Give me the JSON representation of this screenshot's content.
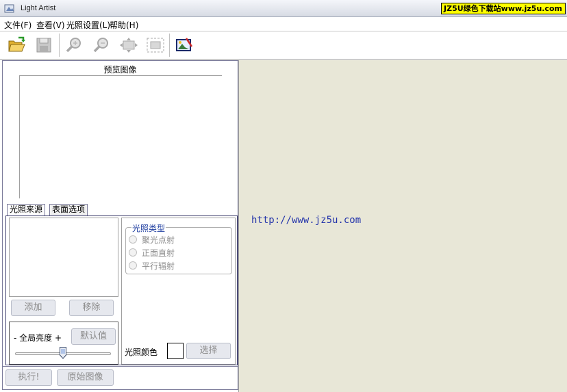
{
  "window": {
    "title": "Light Artist",
    "watermark": "JZ5U绿色下载站www.jz5u.com"
  },
  "menu": {
    "file": "文件(F)",
    "view": "查看(V)",
    "light_settings": "光照设置(L)",
    "help": "帮助(H)"
  },
  "toolbar": {
    "buttons": [
      "open-folder-icon",
      "save-disk-icon",
      "zoom-in-icon",
      "zoom-out-icon",
      "fit-window-icon",
      "actual-size-icon",
      "edit-image-icon"
    ]
  },
  "preview": {
    "label": "预览图像"
  },
  "tabs": {
    "light_source": "光照来源",
    "surface_options": "表面选项"
  },
  "source_panel": {
    "add": "添加",
    "remove": "移除",
    "brightness_label": "- 全局亮度 +",
    "default": "默认值",
    "brightness_level": 0.5
  },
  "light_type": {
    "legend": "光照类型",
    "options": [
      "聚光点射",
      "正面直射",
      "平行辐射"
    ]
  },
  "light_color": {
    "label": "光照颜色",
    "select": "选择",
    "value": "#ffffff"
  },
  "actions": {
    "execute": "执行!",
    "original_image": "原始图像"
  },
  "canvas": {
    "text": "http://www.jz5u.com",
    "background": "#e8e7d7"
  }
}
